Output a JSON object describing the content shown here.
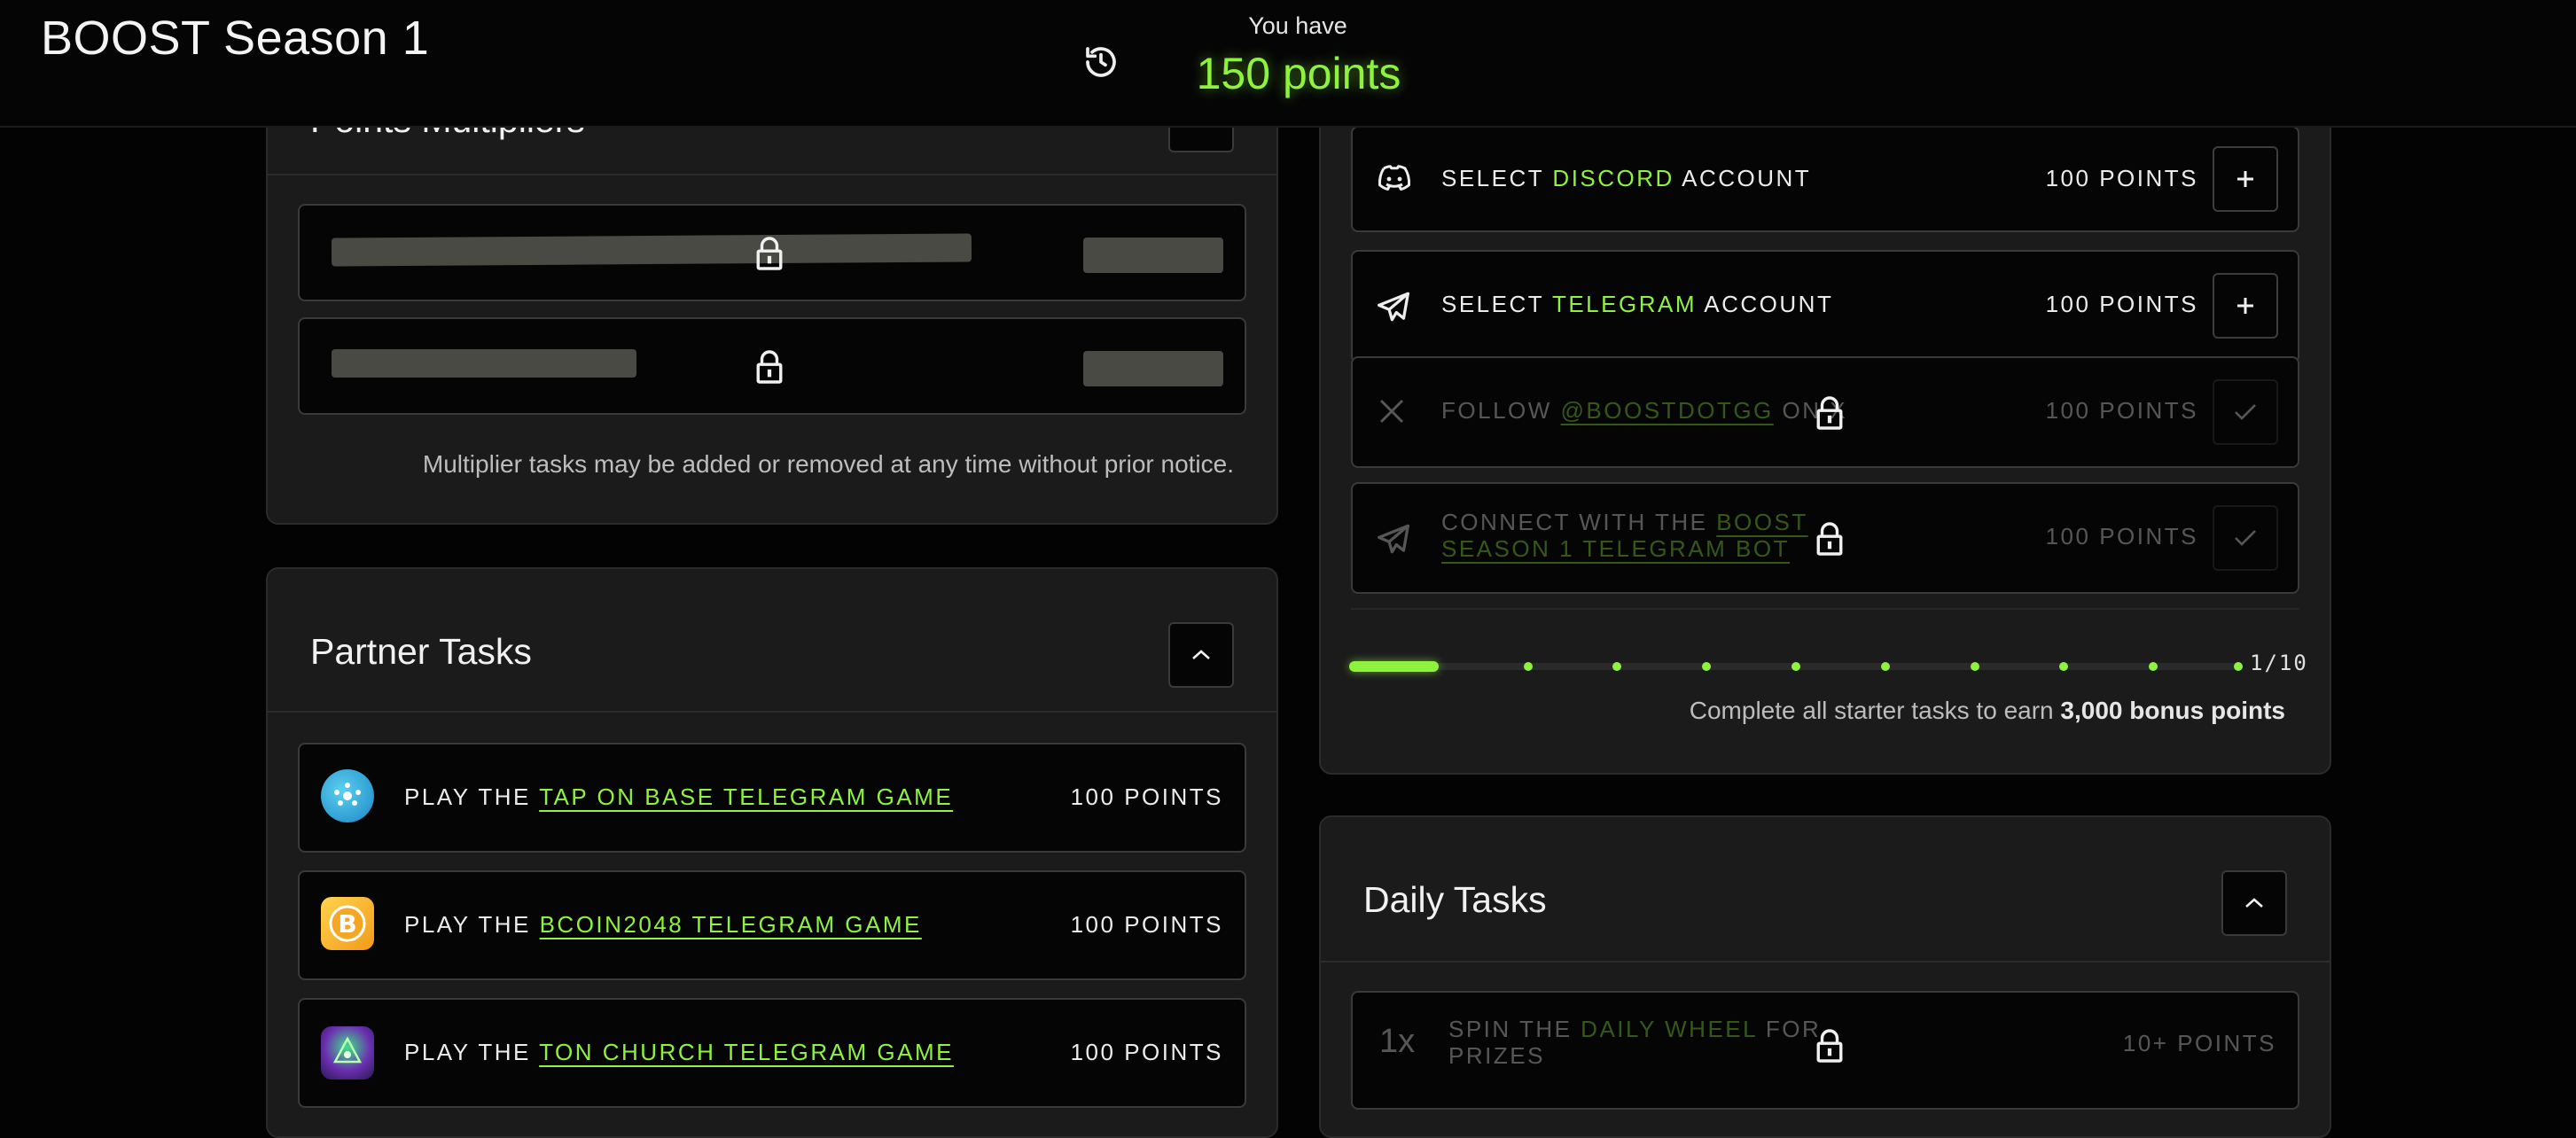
{
  "header": {
    "title": "BOOST Season 1",
    "you_have_label": "You have",
    "points_total": "150 points",
    "history_icon": "history-icon"
  },
  "points_multipliers": {
    "title": "Points Multipliers",
    "note": "Multiplier tasks may be added or removed at any time without prior notice."
  },
  "partner_tasks": {
    "title": "Partner Tasks",
    "items": [
      {
        "prefix": "PLAY THE",
        "link": "TAP ON BASE TELEGRAM GAME",
        "points": "100 POINTS",
        "icon": "tap-on-base-icon"
      },
      {
        "prefix": "PLAY THE",
        "link": "BCOIN2048 TELEGRAM GAME",
        "points": "100 POINTS",
        "icon": "bcoin-icon"
      },
      {
        "prefix": "PLAY THE",
        "link": "TON CHURCH TELEGRAM GAME",
        "points": "100 POINTS",
        "icon": "ton-church-icon"
      }
    ]
  },
  "starter_tasks": {
    "items": [
      {
        "prefix": "SELECT",
        "highlight": "DISCORD",
        "suffix": "ACCOUNT",
        "points": "100 POINTS",
        "icon": "discord-icon"
      },
      {
        "prefix": "SELECT",
        "highlight": "TELEGRAM",
        "suffix": "ACCOUNT",
        "points": "100 POINTS",
        "icon": "telegram-icon"
      },
      {
        "prefix": "FOLLOW",
        "link": "@BOOSTDOTGG",
        "suffix": "ON X",
        "points": "100 POINTS",
        "icon": "x-logo-icon"
      },
      {
        "prefix": "CONNECT WITH THE",
        "link_line1": "BOOST",
        "link_line2": "SEASON 1 TELEGRAM BOT",
        "points": "100 POINTS",
        "icon": "telegram-icon"
      }
    ],
    "progress": {
      "completed": 1,
      "total": 10,
      "label": "1/10"
    },
    "bonus_text": "Complete all starter tasks to earn",
    "bonus_value": "3,000 bonus points"
  },
  "daily_tasks": {
    "title": "Daily Tasks",
    "items": [
      {
        "multiplier": "1x",
        "prefix": "SPIN THE",
        "highlight": "DAILY WHEEL",
        "suffix": "FOR",
        "line2": "PRIZES",
        "points": "10+ POINTS"
      }
    ]
  },
  "colors": {
    "accent": "#8ef23f",
    "background": "#030303",
    "panel": "#1b1b1b"
  }
}
